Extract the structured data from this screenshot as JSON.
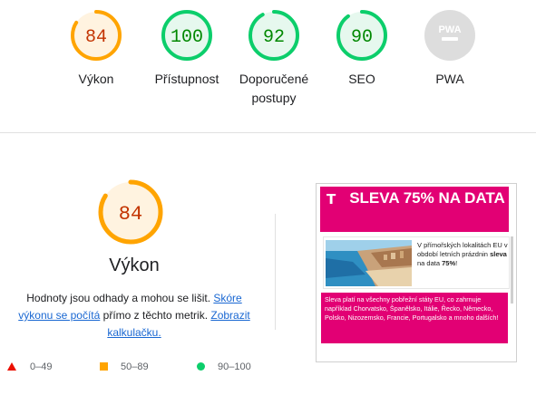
{
  "gauges": [
    {
      "label": "Výkon",
      "score": "84",
      "score_value": 84,
      "category": "average",
      "color": "#ffa400",
      "track": "#fff3e0",
      "text_color": "#c33300"
    },
    {
      "label": "Přístupnost",
      "score": "100",
      "score_value": 100,
      "category": "pass",
      "color": "#0cce6b",
      "track": "#e6f8ee",
      "text_color": "#008800"
    },
    {
      "label_line1": "Doporučené",
      "label_line2": "postupy",
      "score": "92",
      "score_value": 92,
      "category": "pass",
      "color": "#0cce6b",
      "track": "#e6f8ee",
      "text_color": "#008800"
    },
    {
      "label": "SEO",
      "score": "90",
      "score_value": 90,
      "category": "pass",
      "color": "#0cce6b",
      "track": "#e6f8ee",
      "text_color": "#008800"
    },
    {
      "label": "PWA",
      "badge": "PWA",
      "icon": "pwa-badge-icon",
      "category": "na",
      "color": "#dddddd"
    }
  ],
  "performance": {
    "score": "84",
    "score_value": 84,
    "title": "Výkon",
    "desc_before_link1": "Hodnoty jsou odhady a mohou se lišit. ",
    "link1": "Skóre výkonu se počítá",
    "desc_middle": " přímo z těchto metrik. ",
    "link2": "Zobrazit kalkulačku.",
    "color": "#ffa400",
    "text_color": "#c33300"
  },
  "legend": [
    {
      "icon": "fail-triangle-icon",
      "range": "0–49",
      "color": "#eb0f00"
    },
    {
      "icon": "average-square-icon",
      "range": "50–89",
      "color": "#ffa400"
    },
    {
      "icon": "pass-circle-icon",
      "range": "90–100",
      "color": "#0cce6b"
    }
  ],
  "screenshot": {
    "logo": "T",
    "headline": "SLEVA 75% NA DATA",
    "card_text_before": "V přímořských lokalitách EU v období letních prázdnin ",
    "card_text_bold": "sleva",
    "card_text_mid": " na data ",
    "card_text_bold2": "75%",
    "card_text_end": "!",
    "pink_text": "Sleva platí na všechny pobřežní státy EU, co zahrnuje například Chorvatsko, Španělsko, Itálie, Řecko, Německo, Polsko, Nizozemsko, Francie, Portugalsko a mnoho dalších!",
    "brand_color": "#e20074"
  }
}
